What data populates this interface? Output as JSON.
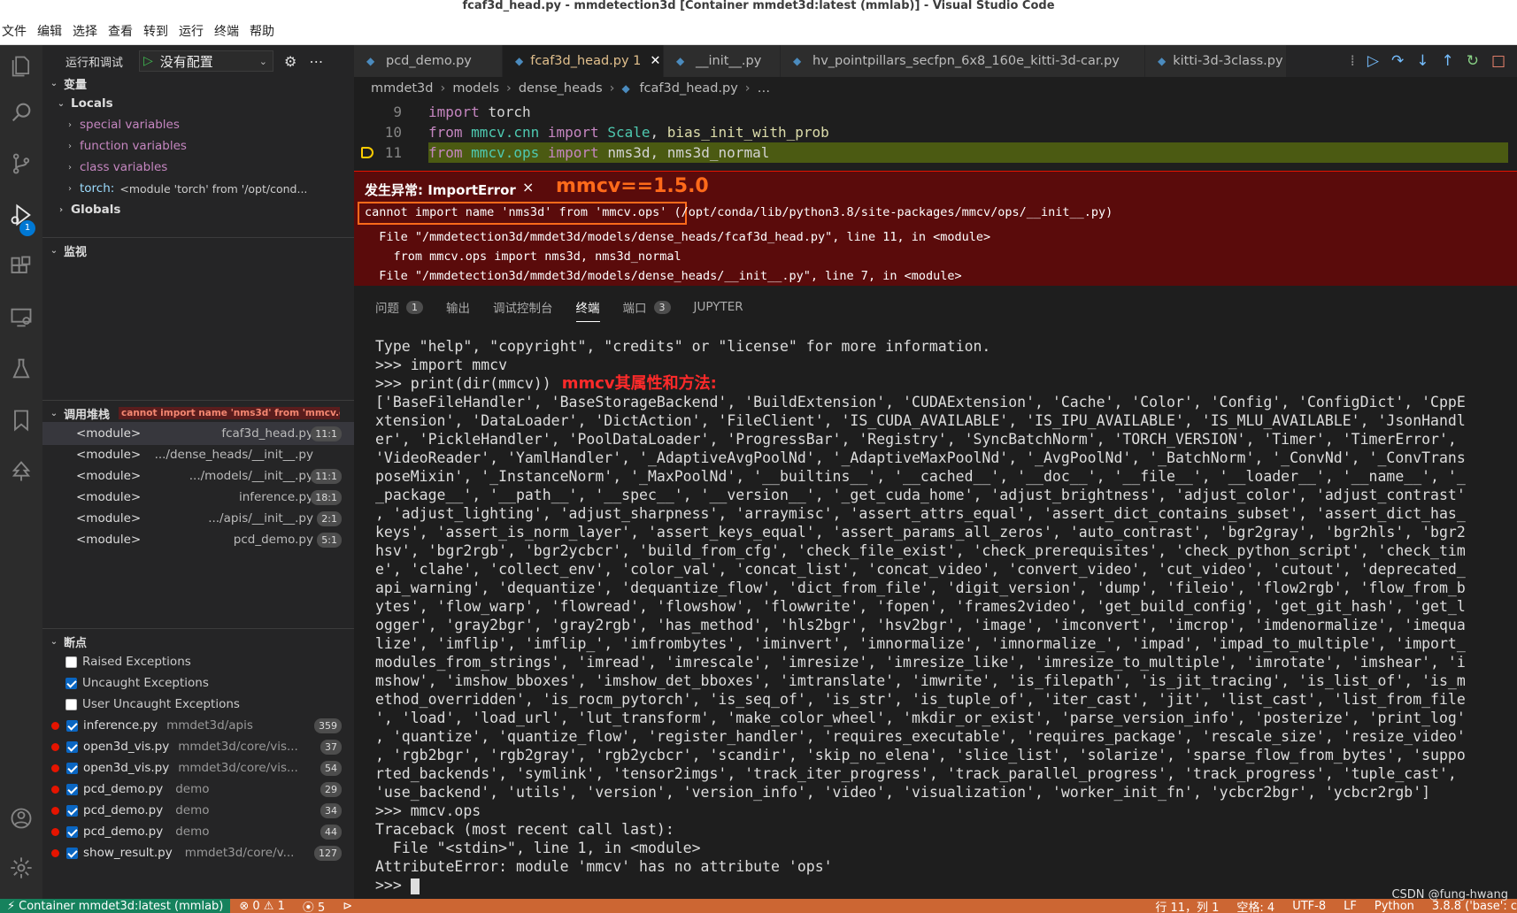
{
  "window": {
    "title": "fcaf3d_head.py - mmdetection3d [Container mmdet3d:latest (mmlab)] - Visual Studio Code"
  },
  "menu": [
    "文件",
    "编辑",
    "选择",
    "查看",
    "转到",
    "运行",
    "终端",
    "帮助"
  ],
  "activity": {
    "debug_badge": "1"
  },
  "sidebar": {
    "run_label": "运行和调试",
    "config_label": "没有配置",
    "variables_title": "变量",
    "locals_title": "Locals",
    "locals": [
      "special variables",
      "function variables",
      "class variables"
    ],
    "torch_label": "torch:",
    "torch_value": "<module 'torch' from '/opt/cond...",
    "globals_title": "Globals",
    "watch_title": "监视",
    "callstack_title": "调用堆栈",
    "callstack_error": "cannot import name 'nms3d' from 'mmcv.ops' (...",
    "stack": [
      {
        "module": "<module>",
        "file": "fcaf3d_head.py",
        "line": "11:1"
      },
      {
        "module": "<module>",
        "file": ".../dense_heads/__init__.py",
        "line": ""
      },
      {
        "module": "<module>",
        "file": ".../models/__init__.py",
        "line": "11:1"
      },
      {
        "module": "<module>",
        "file": "inference.py",
        "line": "18:1"
      },
      {
        "module": "<module>",
        "file": ".../apis/__init__.py",
        "line": "2:1"
      },
      {
        "module": "<module>",
        "file": "pcd_demo.py",
        "line": "5:1"
      }
    ],
    "breakpoints_title": "断点",
    "exception_bps": [
      {
        "label": "Raised Exceptions",
        "checked": false
      },
      {
        "label": "Uncaught Exceptions",
        "checked": true
      },
      {
        "label": "User Uncaught Exceptions",
        "checked": false
      }
    ],
    "breakpoints": [
      {
        "file": "inference.py",
        "path": "mmdet3d/apis",
        "line": "359"
      },
      {
        "file": "open3d_vis.py",
        "path": "mmdet3d/core/vis...",
        "line": "37"
      },
      {
        "file": "open3d_vis.py",
        "path": "mmdet3d/core/vis...",
        "line": "54"
      },
      {
        "file": "pcd_demo.py",
        "path": "demo",
        "line": "29"
      },
      {
        "file": "pcd_demo.py",
        "path": "demo",
        "line": "34"
      },
      {
        "file": "pcd_demo.py",
        "path": "demo",
        "line": "44"
      },
      {
        "file": "show_result.py",
        "path": "mmdet3d/core/v...",
        "line": "127"
      }
    ]
  },
  "tabs": [
    {
      "label": "pcd_demo.py",
      "active": false
    },
    {
      "label": "fcaf3d_head.py 1",
      "active": true
    },
    {
      "label": "__init__.py",
      "active": false
    },
    {
      "label": "hv_pointpillars_secfpn_6x8_160e_kitti-3d-car.py",
      "active": false
    },
    {
      "label": "kitti-3d-3class.py",
      "active": false
    }
  ],
  "breadcrumb": [
    "mmdet3d",
    "models",
    "dense_heads",
    "fcaf3d_head.py",
    "…"
  ],
  "code": [
    {
      "n": "9",
      "text": "import torch"
    },
    {
      "n": "10",
      "text": "from mmcv.cnn import Scale, bias_init_with_prob"
    },
    {
      "n": "11",
      "text": "from mmcv.ops import nms3d, nms3d_normal"
    }
  ],
  "exception": {
    "title": "发生异常: ImportError",
    "annotation": "mmcv==1.5.0",
    "lines": [
      "cannot import name 'nms3d' from 'mmcv.ops' (/opt/conda/lib/python3.8/site-packages/mmcv/ops/__init__.py)",
      "  File \"/mmdetection3d/mmdet3d/models/dense_heads/fcaf3d_head.py\", line 11, in <module>",
      "    from mmcv.ops import nms3d, nms3d_normal",
      "  File \"/mmdetection3d/mmdet3d/models/dense_heads/__init__.py\", line 7, in <module>"
    ]
  },
  "panel": {
    "tabs": [
      {
        "label": "问题",
        "badge": "1"
      },
      {
        "label": "输出",
        "badge": ""
      },
      {
        "label": "调试控制台",
        "badge": ""
      },
      {
        "label": "终端",
        "badge": ""
      },
      {
        "label": "端口",
        "badge": "3"
      },
      {
        "label": "JUPYTER",
        "badge": ""
      }
    ],
    "active_tab": "终端"
  },
  "terminal": {
    "annotation": "mmcv其属性和方法:",
    "lines": [
      "Type \"help\", \"copyright\", \"credits\" or \"license\" for more information.",
      ">>> import mmcv",
      ">>> print(dir(mmcv))",
      "['BaseFileHandler', 'BaseStorageBackend', 'BuildExtension', 'CUDAExtension', 'Cache', 'Color', 'Config', 'ConfigDict', 'CppE",
      "xtension', 'DataLoader', 'DictAction', 'FileClient', 'IS_CUDA_AVAILABLE', 'IS_IPU_AVAILABLE', 'IS_MLU_AVAILABLE', 'JsonHandl",
      "er', 'PickleHandler', 'PoolDataLoader', 'ProgressBar', 'Registry', 'SyncBatchNorm', 'TORCH_VERSION', 'Timer', 'TimerError',",
      "'VideoReader', 'YamlHandler', '_AdaptiveAvgPoolNd', '_AdaptiveMaxPoolNd', '_AvgPoolNd', '_BatchNorm', '_ConvNd', '_ConvTrans",
      "poseMixin', '_InstanceNorm', '_MaxPoolNd', '__builtins__', '__cached__', '__doc__', '__file__', '__loader__', '__name__', '_",
      "_package__', '__path__', '__spec__', '__version__', '_get_cuda_home', 'adjust_brightness', 'adjust_color', 'adjust_contrast'",
      ", 'adjust_lighting', 'adjust_sharpness', 'arraymisc', 'assert_attrs_equal', 'assert_dict_contains_subset', 'assert_dict_has_",
      "keys', 'assert_is_norm_layer', 'assert_keys_equal', 'assert_params_all_zeros', 'auto_contrast', 'bgr2gray', 'bgr2hls', 'bgr2",
      "hsv', 'bgr2rgb', 'bgr2ycbcr', 'build_from_cfg', 'check_file_exist', 'check_prerequisites', 'check_python_script', 'check_tim",
      "e', 'clahe', 'collect_env', 'color_val', 'concat_list', 'concat_video', 'convert_video', 'cut_video', 'cutout', 'deprecated_",
      "api_warning', 'dequantize', 'dequantize_flow', 'dict_from_file', 'digit_version', 'dump', 'fileio', 'flow2rgb', 'flow_from_b",
      "ytes', 'flow_warp', 'flowread', 'flowshow', 'flowwrite', 'fopen', 'frames2video', 'get_build_config', 'get_git_hash', 'get_l",
      "ogger', 'gray2bgr', 'gray2rgb', 'has_method', 'hls2bgr', 'hsv2bgr', 'image', 'imconvert', 'imcrop', 'imdenormalize', 'imequa",
      "lize', 'imflip', 'imflip_', 'imfrombytes', 'iminvert', 'imnormalize', 'imnormalize_', 'impad', 'impad_to_multiple', 'import_",
      "modules_from_strings', 'imread', 'imrescale', 'imresize', 'imresize_like', 'imresize_to_multiple', 'imrotate', 'imshear', 'i",
      "mshow', 'imshow_bboxes', 'imshow_det_bboxes', 'imtranslate', 'imwrite', 'is_filepath', 'is_jit_tracing', 'is_list_of', 'is_m",
      "ethod_overridden', 'is_rocm_pytorch', 'is_seq_of', 'is_str', 'is_tuple_of', 'iter_cast', 'jit', 'list_cast', 'list_from_file",
      "', 'load', 'load_url', 'lut_transform', 'make_color_wheel', 'mkdir_or_exist', 'parse_version_info', 'posterize', 'print_log'",
      ", 'quantize', 'quantize_flow', 'register_handler', 'requires_executable', 'requires_package', 'rescale_size', 'resize_video'",
      ", 'rgb2bgr', 'rgb2gray', 'rgb2ycbcr', 'scandir', 'skip_no_elena', 'slice_list', 'solarize', 'sparse_flow_from_bytes', 'suppo",
      "rted_backends', 'symlink', 'tensor2imgs', 'track_iter_progress', 'track_parallel_progress', 'track_progress', 'tuple_cast',",
      "'use_backend', 'utils', 'version', 'version_info', 'video', 'visualization', 'worker_init_fn', 'ycbcr2bgr', 'ycbcr2rgb']",
      ">>> mmcv.ops",
      "Traceback (most recent call last):",
      "  File \"<stdin>\", line 1, in <module>",
      "AttributeError: module 'mmcv' has no attribute 'ops'",
      ">>> "
    ]
  },
  "status": {
    "remote": "Container mmdet3d:latest (mmlab)",
    "problems": "⊗ 0 ⚠ 1",
    "ports": "5",
    "position": "行 11，列 1",
    "spaces": "空格: 4",
    "encoding": "UTF-8",
    "eol": "LF",
    "language": "Python",
    "interpreter": "3.8.8 ('base': c"
  },
  "watermark": "CSDN @fung-hwang",
  "colors": {
    "accent": "#0078d4",
    "status_bar": "#cc6633",
    "error_bg": "#5a0b0b",
    "annotation": "#ff6a1a"
  }
}
